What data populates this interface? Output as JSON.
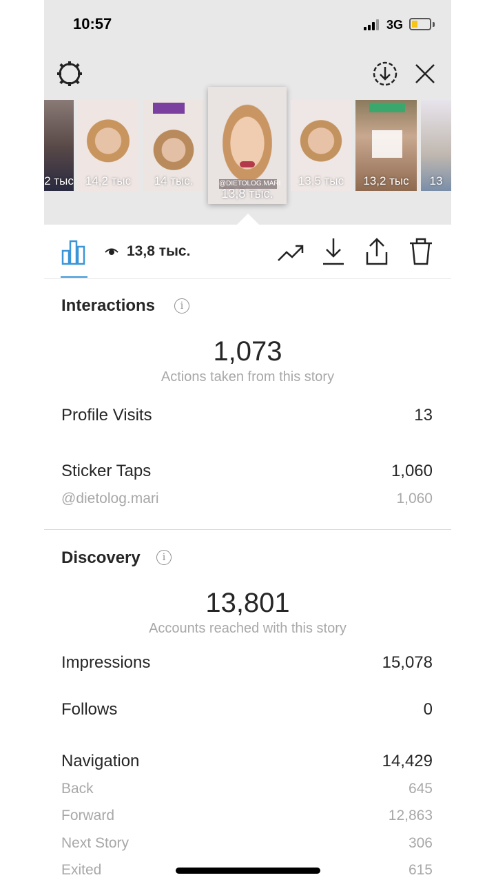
{
  "status_bar": {
    "time": "10:57",
    "network": "3G"
  },
  "stories": [
    {
      "views": "2 тыс",
      "accent": "#6e5a55"
    },
    {
      "views": "14,2 тыс",
      "accent": "#c8a58e"
    },
    {
      "views": "14 тыс.",
      "accent": "#b59a8c"
    },
    {
      "views": "13,8 тыс.",
      "accent": "#caa07f",
      "handle": "@DIETOLOG.MARI"
    },
    {
      "views": "13,5 тыс",
      "accent": "#c89a7f"
    },
    {
      "views": "13,2 тыс",
      "accent": "#a88060"
    },
    {
      "views": "13",
      "accent": "#b8b0a0"
    }
  ],
  "toolbar": {
    "views": "13,8 тыс."
  },
  "interactions": {
    "title": "Interactions",
    "total": "1,073",
    "subtitle": "Actions taken from this story",
    "profile_visits_label": "Profile Visits",
    "profile_visits_value": "13",
    "sticker_taps_label": "Sticker Taps",
    "sticker_taps_value": "1,060",
    "sticker_handle_label": "@dietolog.mari",
    "sticker_handle_value": "1,060"
  },
  "discovery": {
    "title": "Discovery",
    "total": "13,801",
    "subtitle": "Accounts reached with this story",
    "impressions_label": "Impressions",
    "impressions_value": "15,078",
    "follows_label": "Follows",
    "follows_value": "0",
    "navigation_label": "Navigation",
    "navigation_value": "14,429",
    "back_label": "Back",
    "back_value": "645",
    "forward_label": "Forward",
    "forward_value": "12,863",
    "next_story_label": "Next Story",
    "next_story_value": "306",
    "exited_label": "Exited",
    "exited_value": "615"
  },
  "colors": {
    "accent_blue": "#3b95d6",
    "battery": "#f5c518",
    "purple_label": "#7b3fa0"
  },
  "battery_level": 0.35
}
